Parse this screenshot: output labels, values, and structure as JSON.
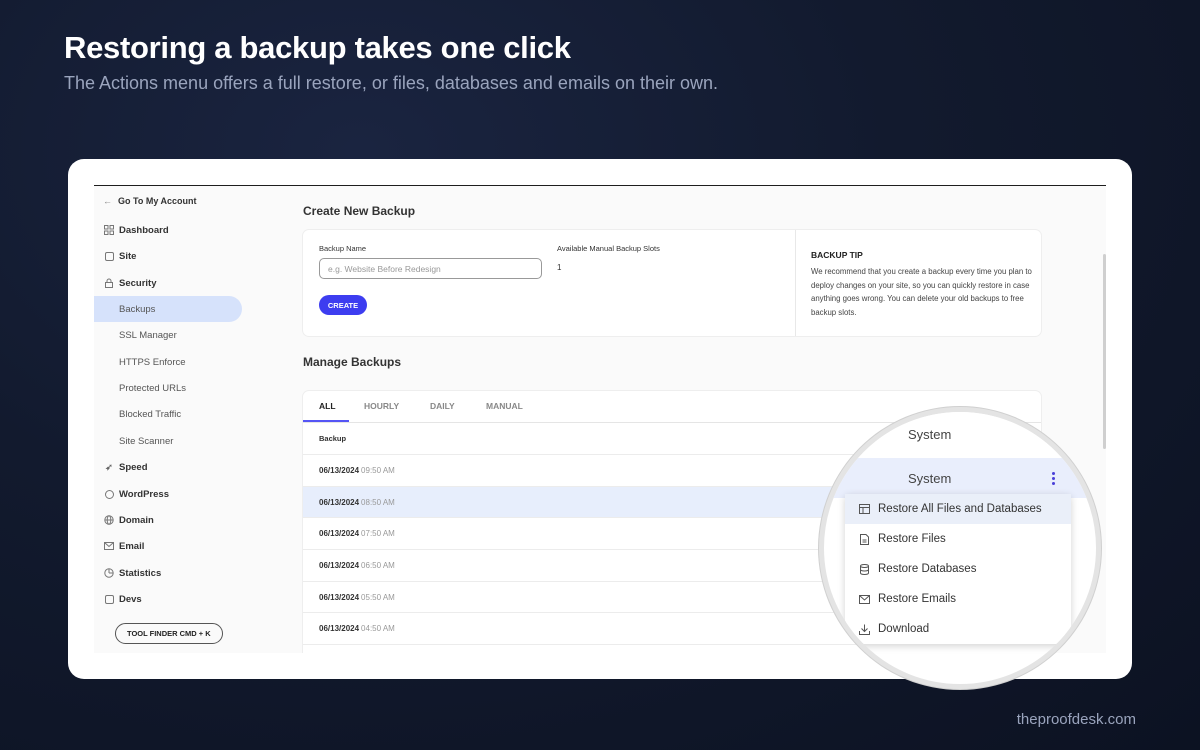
{
  "slide": {
    "headline": "Restoring a backup takes one click",
    "subline": "The Actions menu offers a full restore, or files, databases and emails on their own.",
    "brand": "theproofdesk.com"
  },
  "sidebar": {
    "back_label": "Go To My Account",
    "items": [
      {
        "label": "Dashboard",
        "icon": "grid-icon"
      },
      {
        "label": "Site",
        "icon": "site-icon"
      },
      {
        "label": "Security",
        "icon": "lock-icon"
      },
      {
        "label": "Backups",
        "active": true
      },
      {
        "label": "SSL Manager"
      },
      {
        "label": "HTTPS Enforce"
      },
      {
        "label": "Protected URLs"
      },
      {
        "label": "Blocked Traffic"
      },
      {
        "label": "Site Scanner"
      },
      {
        "label": "Speed",
        "icon": "rocket-icon"
      },
      {
        "label": "WordPress",
        "icon": "wordpress-icon"
      },
      {
        "label": "Domain",
        "icon": "globe-icon"
      },
      {
        "label": "Email",
        "icon": "envelope-icon"
      },
      {
        "label": "Statistics",
        "icon": "pie-chart-icon"
      },
      {
        "label": "Devs",
        "icon": "devs-icon"
      }
    ],
    "tool_finder": "TOOL FINDER CMD + K"
  },
  "create": {
    "title": "Create New Backup",
    "name_label": "Backup Name",
    "name_placeholder": "e.g. Website Before Redesign",
    "slots_label": "Available Manual Backup Slots",
    "slots_value": "1",
    "button": "CREATE",
    "tip_title": "BACKUP TIP",
    "tip_body": "We recommend that you create a backup every time you plan to deploy changes on your site, so you can quickly restore in case anything goes wrong. You can delete your old backups to free backup slots."
  },
  "manage": {
    "title": "Manage Backups",
    "tabs": [
      "ALL",
      "HOURLY",
      "DAILY",
      "MANUAL"
    ],
    "active_tab": "ALL",
    "column": "Backup",
    "rows": [
      {
        "date": "06/13/2024",
        "time": "09:50 AM"
      },
      {
        "date": "06/13/2024",
        "time": "08:50 AM"
      },
      {
        "date": "06/13/2024",
        "time": "07:50 AM"
      },
      {
        "date": "06/13/2024",
        "time": "06:50 AM"
      },
      {
        "date": "06/13/2024",
        "time": "05:50 AM"
      },
      {
        "date": "06/13/2024",
        "time": "04:50 AM"
      }
    ],
    "highlighted_row": "06/13/2024 08:50 AM"
  },
  "lens": {
    "type_top": "System",
    "type_highlight": "System",
    "actions": [
      {
        "label": "Restore All Files and Databases",
        "icon": "restore-all-icon"
      },
      {
        "label": "Restore Files",
        "icon": "file-icon"
      },
      {
        "label": "Restore Databases",
        "icon": "database-icon"
      },
      {
        "label": "Restore Emails",
        "icon": "envelope-icon"
      },
      {
        "label": "Download",
        "icon": "download-icon"
      }
    ]
  }
}
